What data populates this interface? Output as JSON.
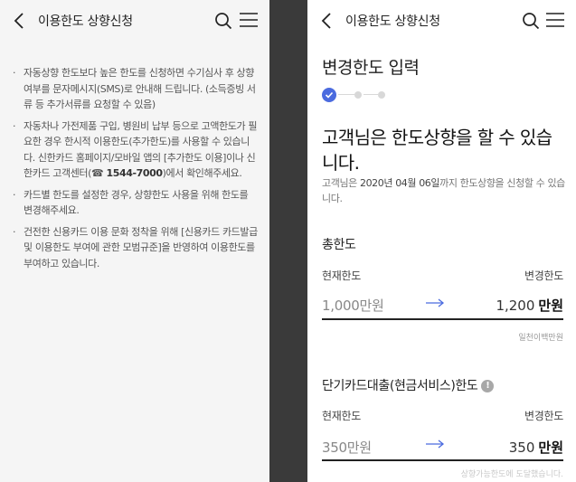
{
  "left": {
    "header": {
      "title": "이용한도 상향신청"
    },
    "notices": [
      {
        "text": "자동상향 한도보다 높은 한도를 신청하면 수기심사 후 상향여부를 문자메시지(SMS)로 안내해 드립니다. (소득증빙 서류 등 추가서류를 요청할 수 있음)"
      },
      {
        "text_before": "자동차나 가전제품 구입, 병원비 납부 등으로 고액한도가 필요한 경우 한시적 이용한도(추가한도)를 사용할 수 있습니다. 신한카드 홈페이지/모바일 앱의 [추가한도 이용]이나 신한카드 고객센터(☎ ",
        "phone": "1544-7000",
        "text_after": ")에서 확인해주세요."
      },
      {
        "text": "카드별 한도를 설정한 경우, 상향한도 사용을 위해 한도를 변경해주세요."
      },
      {
        "text": "건전한 신용카드 이용 문화 정착을 위해 [신용카드 카드발급 및 이용한도 부여에 관한 모범규준]을 반영하여 이용한도를 부여하고 있습니다."
      }
    ]
  },
  "right": {
    "header": {
      "title": "이용한도 상향신청"
    },
    "step_title": "변경한도 입력",
    "stepper": {
      "current": 1,
      "total": 3
    },
    "headline": "고객님은 한도상향을 할 수 있습니다.",
    "subtext": {
      "prefix": "고객님은 ",
      "date": "2020년 04월 06일",
      "suffix": "까지 한도상향을 신청할 수 있습니다."
    },
    "total_limit": {
      "title": "총한도",
      "current_label": "현재한도",
      "new_label": "변경한도",
      "current_value": "1,000만원",
      "new_value": "1,200",
      "new_unit": "만원",
      "hint": "일천이백만원"
    },
    "cash_limit": {
      "title": "단기카드대출(현금서비스)한도",
      "info_icon": "!",
      "current_label": "현재한도",
      "new_label": "변경한도",
      "current_value": "350만원",
      "new_value": "350",
      "new_unit": "만원"
    },
    "bottom_hint": "상향가능한도에 도달했습니다."
  },
  "colors": {
    "accent": "#4b6bdf",
    "divider": "#3a3a3a",
    "left_bg": "#f5f5f5"
  },
  "icons": [
    "back-icon",
    "search-icon",
    "menu-icon",
    "check-icon",
    "arrow-right-icon",
    "info-icon"
  ]
}
